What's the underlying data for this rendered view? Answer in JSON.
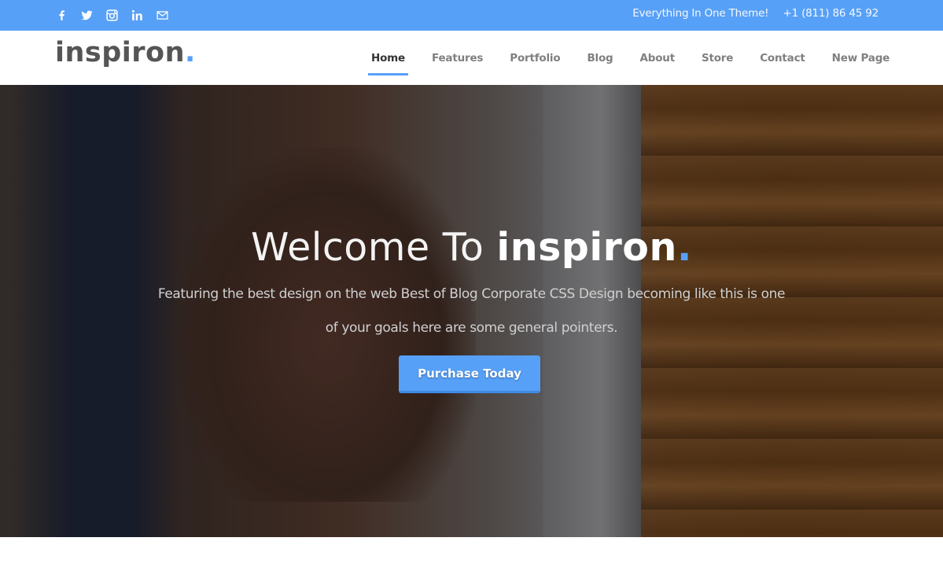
{
  "topbar": {
    "social": [
      {
        "name": "facebook-icon",
        "label": "Facebook"
      },
      {
        "name": "twitter-icon",
        "label": "Twitter"
      },
      {
        "name": "instagram-icon",
        "label": "Instagram"
      },
      {
        "name": "linkedin-icon",
        "label": "LinkedIn"
      },
      {
        "name": "mail-icon",
        "label": "Email"
      }
    ],
    "tagline": "Everything In One Theme!",
    "phone": "+1 (811)  86 45 92"
  },
  "brand": {
    "logo_text": "inspiron",
    "logo_dot": ".",
    "accent_color": "#57a0f7"
  },
  "nav": {
    "items": [
      {
        "label": "Home",
        "active": true
      },
      {
        "label": "Features",
        "active": false
      },
      {
        "label": "Portfolio",
        "active": false
      },
      {
        "label": "Blog",
        "active": false
      },
      {
        "label": "About",
        "active": false
      },
      {
        "label": "Store",
        "active": false
      },
      {
        "label": "Contact",
        "active": false
      },
      {
        "label": "New Page",
        "active": false
      }
    ]
  },
  "hero": {
    "title_prefix": "Welcome To ",
    "title_brand": "inspiron",
    "title_dot": ".",
    "subtitle": "Featuring the best design on the web Best of Blog Corporate CSS Design becoming like this is one of your goals here are some general pointers.",
    "cta_label": "Purchase Today"
  }
}
